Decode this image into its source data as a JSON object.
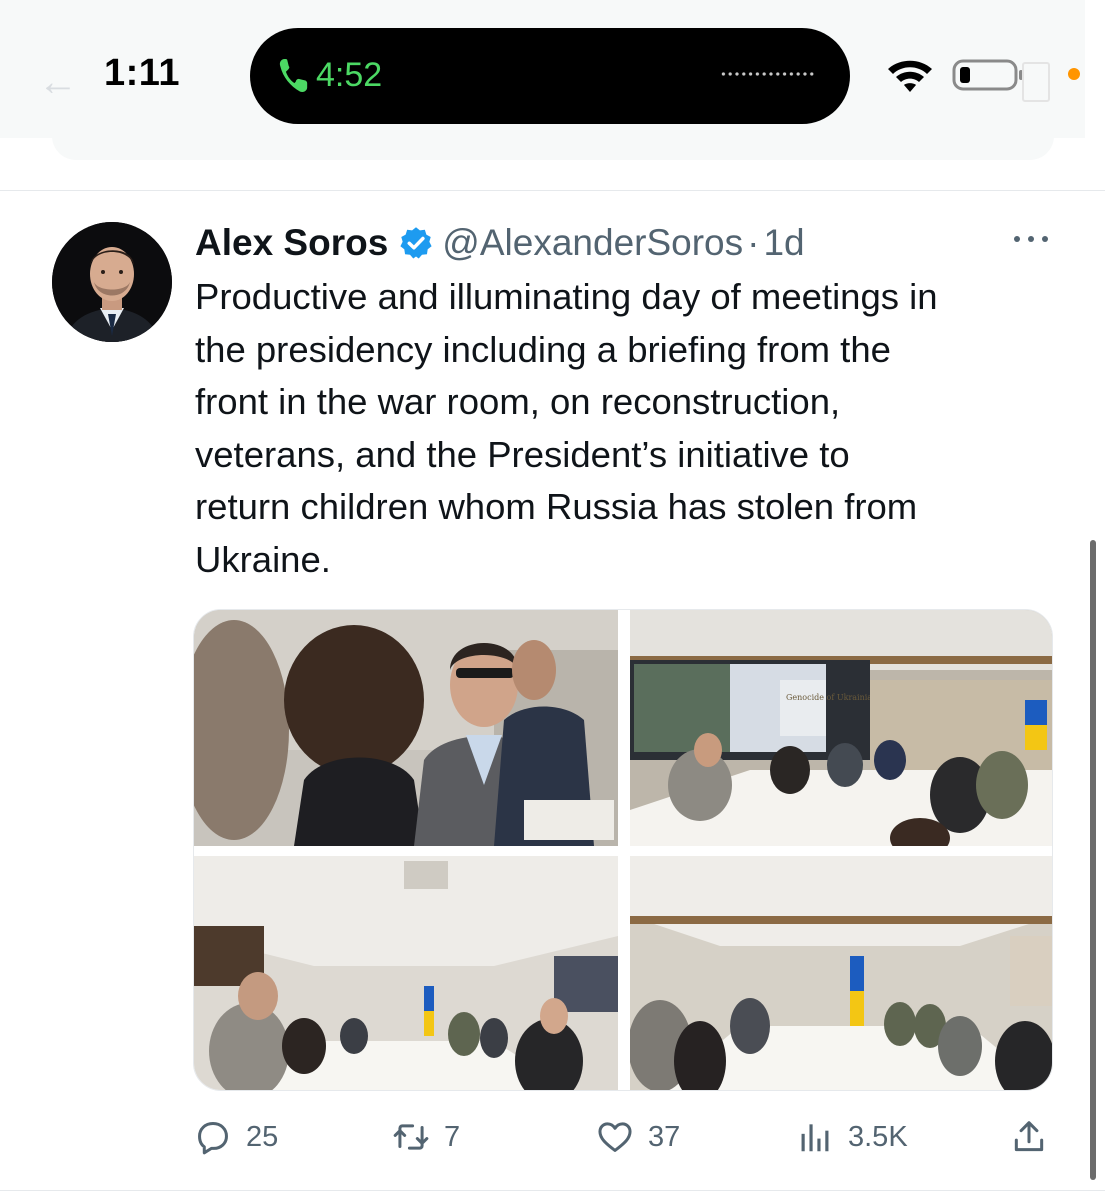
{
  "status_bar": {
    "time": "1:11",
    "call_timer": "4:52",
    "icons": [
      "phone-icon",
      "wifi-icon",
      "battery-icon"
    ],
    "accent_call": "#4cd964",
    "privacy_dot_color": "#ff9500"
  },
  "tweet": {
    "author": {
      "display_name": "Alex Soros",
      "handle": "@AlexanderSoros",
      "verified": true
    },
    "separator": "·",
    "time_ago": "1d",
    "text": "Productive and illuminating day of meetings in\nthe presidency including a briefing from the\nfront in the war room, on reconstruction,\nveterans, and the President’s initiative to\nreturn children whom Russia has stolen from\nUkraine.",
    "media": [
      {
        "caption": ""
      },
      {
        "screen_text": "Genocide of Ukrainian Children"
      },
      {
        "caption": ""
      },
      {
        "caption": ""
      }
    ],
    "actions": {
      "reply_count": "25",
      "retweet_count": "7",
      "like_count": "37",
      "views_count": "3.5K"
    }
  },
  "colors": {
    "text_primary": "#0f1419",
    "text_secondary": "#536471",
    "verified_blue": "#1d9bf0",
    "divider": "#e6e9ec"
  }
}
